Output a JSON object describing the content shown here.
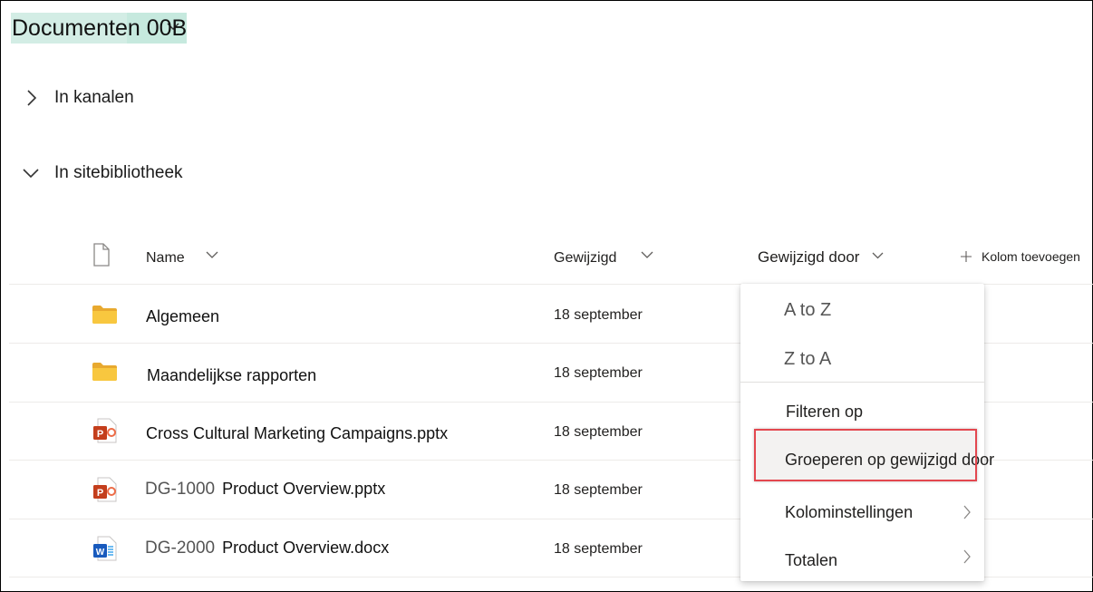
{
  "library": {
    "title": "Documenten 00B"
  },
  "sections": [
    {
      "label": "In kanalen",
      "expanded": false
    },
    {
      "label": "In sitebibliotheek",
      "expanded": true
    }
  ],
  "columns": {
    "name": "Name",
    "modified": "Gewijzigd",
    "modified_by": "Gewijzigd door",
    "add_column": "Kolom toevoegen"
  },
  "rows": [
    {
      "icon": "folder-icon",
      "prefix": "",
      "name": "Algemeen",
      "modified": "18 september"
    },
    {
      "icon": "folder-icon",
      "prefix": "",
      "name": "Maandelijkse rapporten",
      "modified": "18 september"
    },
    {
      "icon": "powerpoint-file-icon",
      "prefix": "",
      "name": "Cross Cultural Marketing Campaigns.pptx",
      "modified": "18 september"
    },
    {
      "icon": "powerpoint-file-icon",
      "prefix": "DG-1000",
      "name": "Product Overview.pptx",
      "modified": "18 september"
    },
    {
      "icon": "word-file-icon",
      "prefix": "DG-2000",
      "name": "Product Overview.docx",
      "modified": "18 september"
    }
  ],
  "column_menu": {
    "sort_asc": "A to Z",
    "sort_desc": "Z to A",
    "filter": "Filteren op",
    "group": "Groeperen op gewijzigd door",
    "settings": "Kolominstellingen",
    "totals": "Totalen"
  },
  "colors": {
    "title_highlight": "#d3ede5",
    "folder": "#f8c73f",
    "powerpoint": "#c43e1c",
    "word": "#185abd",
    "highlight_border": "#e3474f"
  }
}
